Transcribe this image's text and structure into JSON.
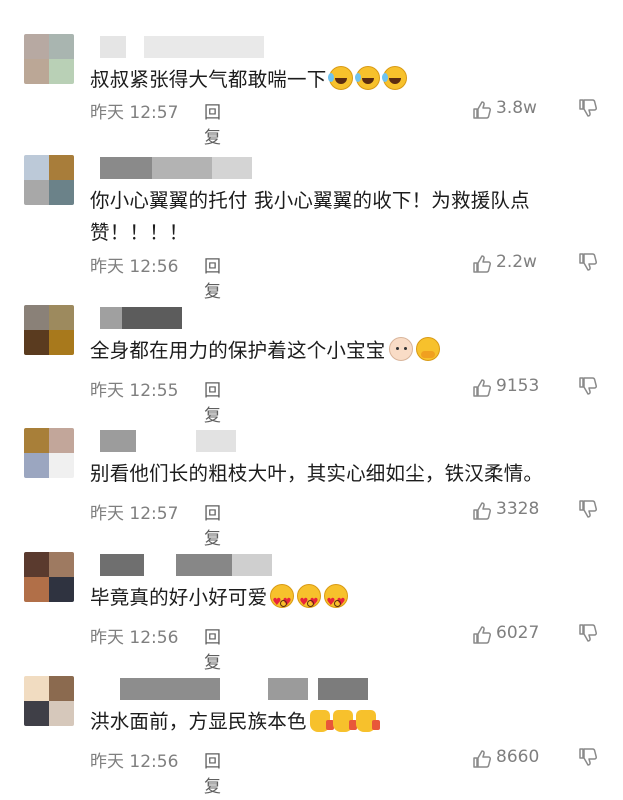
{
  "comments": [
    {
      "avatar_colors": [
        "#b7a9a2",
        "#a9b5b0",
        "#bba796",
        "#b9d0b6"
      ],
      "name_blocks": [
        "#e5e5e5",
        "#e9e9e9",
        "#e0e0e0"
      ],
      "text": "叔叔紧张得大气都敢喘一下",
      "emojis": [
        "laugh",
        "laugh",
        "laugh"
      ],
      "time": "昨天 12:57",
      "reply": "回复",
      "likes": "3.8w"
    },
    {
      "avatar_colors": [
        "#bcc9d8",
        "#a87d3a",
        "#a8a8a8",
        "#6b8289"
      ],
      "name_blocks": [
        "#8a8a8a",
        "#b3b3b3",
        "#d4d4d4"
      ],
      "text": "你小心翼翼的托付 我小心翼翼的收下！为救援队点赞！！！！",
      "emojis": [],
      "time": "昨天 12:56",
      "reply": "回复",
      "likes": "2.2w"
    },
    {
      "avatar_colors": [
        "#8a8178",
        "#9d8a5e",
        "#5a3b1f",
        "#a8791c"
      ],
      "name_blocks": [
        "#a0a0a0",
        "#5c5c5c",
        "#ececec"
      ],
      "text": "全身都在用力的保护着这个小宝宝",
      "emojis": [
        "baby",
        "hug"
      ],
      "time": "昨天 12:55",
      "reply": "回复",
      "likes": "9153"
    },
    {
      "avatar_colors": [
        "#a87f39",
        "#c2a69a",
        "#9ba6c0",
        "#f0f0f0"
      ],
      "name_blocks": [
        "#9c9c9c",
        "#e2e2e2",
        "#dcdcdc"
      ],
      "text": "别看他们长的粗枝大叶，其实心细如尘，铁汉柔情。",
      "emojis": [],
      "time": "昨天 12:57",
      "reply": "回复",
      "likes": "3328"
    },
    {
      "avatar_colors": [
        "#5a3a2e",
        "#9e7a61",
        "#b16f48",
        "#2f3340"
      ],
      "name_blocks": [
        "#6f6f6f",
        "#878787",
        "#cfcfcf"
      ],
      "text": "毕竟真的好小好可爱",
      "emojis": [
        "love",
        "love",
        "love"
      ],
      "time": "昨天 12:56",
      "reply": "回复",
      "likes": "6027"
    },
    {
      "avatar_colors": [
        "#f1dcc1",
        "#8b6a4f",
        "#3f3f47",
        "#d6c8bb"
      ],
      "name_blocks": [
        "#8d8d8d",
        "#9b9b9b",
        "#7c7c7c"
      ],
      "text": "洪水面前，方显民族本色",
      "emojis": [
        "thumb",
        "thumb",
        "thumb"
      ],
      "time": "昨天 12:56",
      "reply": "回复",
      "likes": "8660"
    }
  ]
}
